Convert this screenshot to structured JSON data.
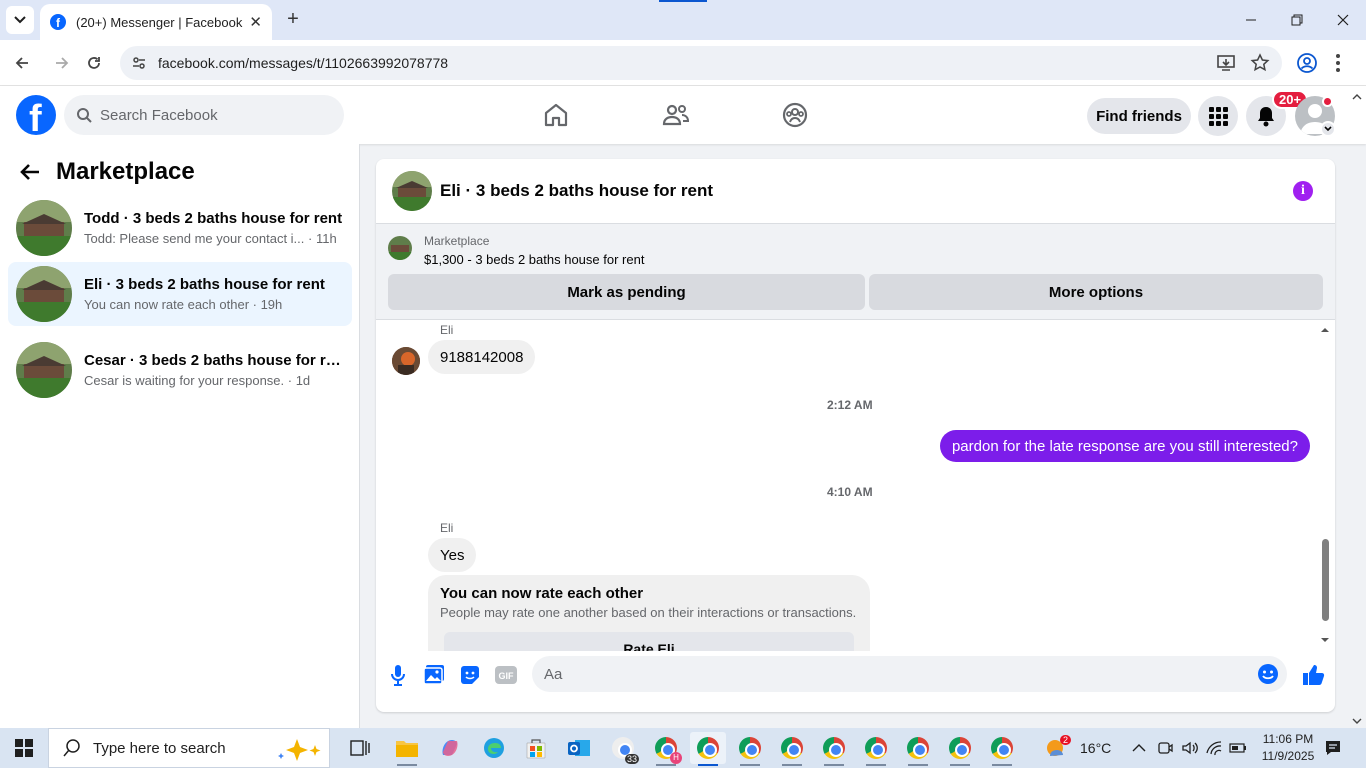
{
  "browser": {
    "tab_title": "(20+) Messenger | Facebook",
    "url": "facebook.com/messages/t/1102663992078778",
    "tab_close": "✕",
    "new_tab": "+"
  },
  "fb": {
    "logo_letter": "f",
    "search_placeholder": "Search Facebook",
    "find_friends": "Find friends",
    "notification_badge": "20+"
  },
  "sidebar": {
    "title": "Marketplace",
    "conversations": [
      {
        "name": "Todd · 3 beds 2 baths house for rent",
        "preview": "Todd: Please send me your contact i... · 11h",
        "active": false
      },
      {
        "name": "Eli · 3 beds 2 baths house for rent",
        "preview": "You can now rate each other · 19h",
        "active": true
      },
      {
        "name": "Cesar · 3 beds 2 baths house for re...",
        "preview": "Cesar is waiting for your response. · 1d",
        "active": false
      }
    ]
  },
  "chat": {
    "title": "Eli · 3 beds 2 baths house for rent",
    "info_icon": "i",
    "marketplace_label": "Marketplace",
    "listing": "$1,300 - 3 beds 2 baths house for rent",
    "mark_pending": "Mark as pending",
    "more_options": "More options",
    "messages": {
      "sender1": "Eli",
      "msg1": "9188142008",
      "time1": "2:12 AM",
      "out1": "pardon for the late response are you still interested?",
      "time2": "4:10 AM",
      "sender2": "Eli",
      "msg2": "Yes",
      "rate_title": "You can now rate each other",
      "rate_sub": "People may rate one another based on their interactions or transactions.",
      "rate_button": "Rate Eli"
    },
    "composer_placeholder": "Aa",
    "accent": "#7c1dea"
  },
  "taskbar": {
    "search_placeholder": "Type here to search",
    "weather": "16°C",
    "weather_badge": "2",
    "time": "11:06 PM",
    "date": "11/9/2025",
    "chrome_badge": "33",
    "profile_letter": "H"
  }
}
